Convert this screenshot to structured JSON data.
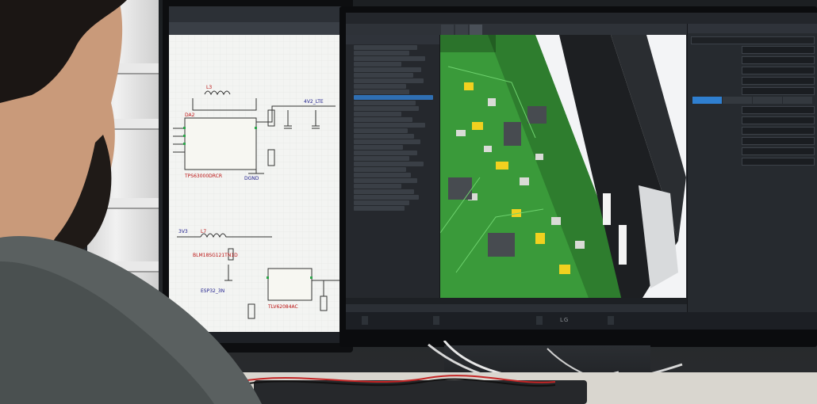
{
  "scene": {
    "description_label": "",
    "left_monitor": {
      "window_title": "",
      "components": [
        "TPS63000DRCR",
        "BLM18SG121TN1D",
        "TLV62084AC"
      ],
      "labels": [
        "4V2_LTE",
        "3V3",
        "ESP32_3N",
        "DGND"
      ]
    },
    "right_monitor": {
      "app_title": "",
      "tabs": [],
      "projects_header": "",
      "properties_header": "",
      "properties": [],
      "segments": [],
      "taskbar": [],
      "brand": "LG"
    }
  }
}
